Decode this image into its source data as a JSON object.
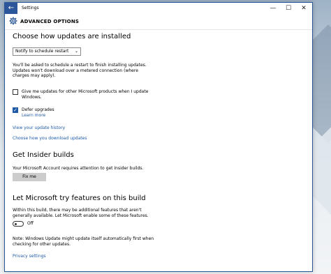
{
  "window": {
    "title": "Settings",
    "controls": {
      "minimize": "—",
      "maximize": "☐",
      "close": "✕"
    },
    "back_glyph": "←"
  },
  "header": {
    "icon": "gear-icon",
    "title": "ADVANCED OPTIONS"
  },
  "updates": {
    "heading": "Choose how updates are installed",
    "dropdown_value": "Notify to schedule restart",
    "restart_note_lines": [
      "You'll be asked to schedule a restart to finish installing updates.",
      "Updates won't download over a metered connection (where",
      "charges may apply)."
    ],
    "other_products": {
      "checked": false,
      "label_lines": [
        "Give me updates for other Microsoft products when I update",
        "Windows."
      ]
    },
    "defer": {
      "checked": true,
      "label": "Defer upgrades",
      "learn_more": "Learn more"
    },
    "history_link": "View your update history",
    "download_link": "Choose how you download updates"
  },
  "insider": {
    "heading": "Get Insider builds",
    "note": "Your Microsoft Account requires attention to get Insider builds.",
    "fix_button": "Fix me"
  },
  "try_features": {
    "heading": "Let Microsoft try features on this build",
    "note_lines": [
      "Within this build, there may be additional features that aren't",
      "generally available. Let Microsoft enable some of these features."
    ],
    "toggle_state": "Off",
    "toggle_on": false,
    "wu_note_lines": [
      "Note: Windows Update might update itself automatically first when",
      "checking for other updates."
    ],
    "privacy_link": "Privacy settings"
  },
  "colors": {
    "accent": "#1e5aa8",
    "titlebar_accent": "#2b579a"
  }
}
